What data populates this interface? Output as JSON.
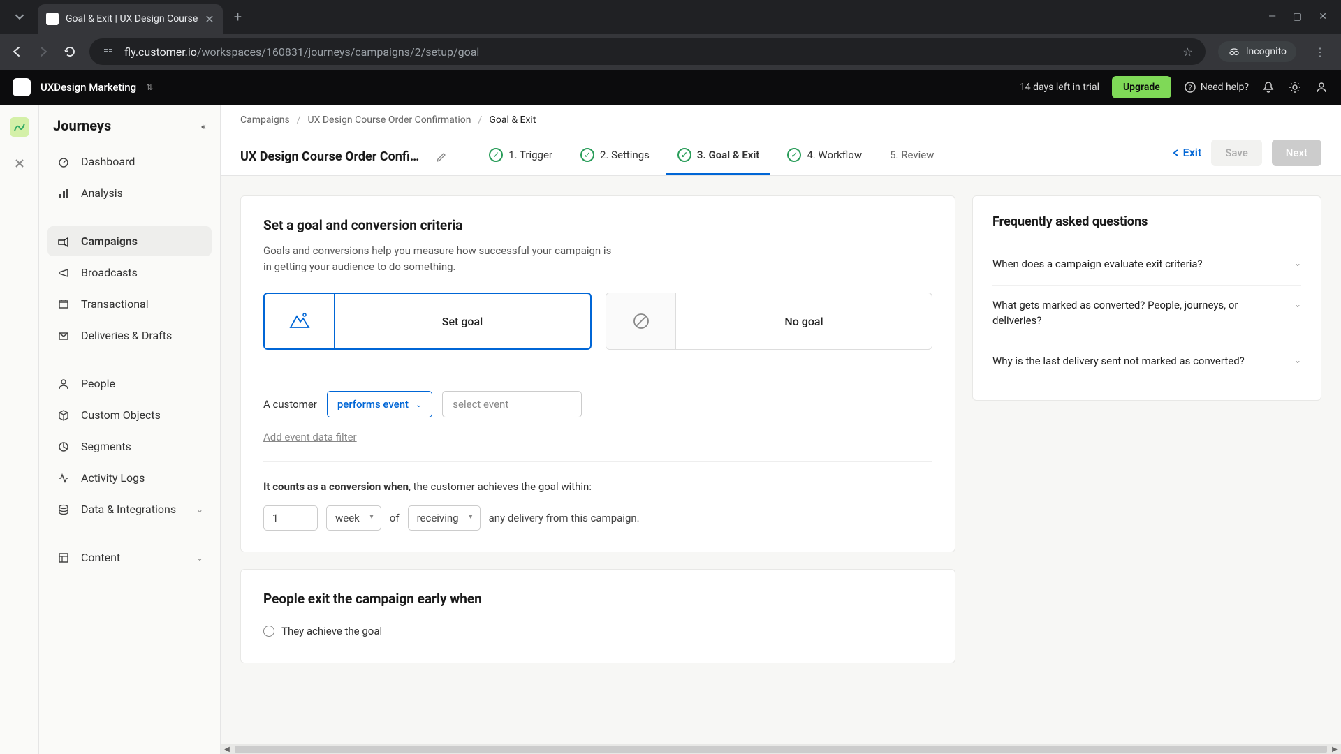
{
  "browser": {
    "tab_title": "Goal & Exit | UX Design Course",
    "url_host": "fly.customer.io",
    "url_path": "/workspaces/160831/journeys/campaigns/2/setup/goal",
    "incognito": "Incognito"
  },
  "topbar": {
    "workspace": "UXDesign Marketing",
    "trial": "14 days left in trial",
    "upgrade": "Upgrade",
    "help": "Need help?"
  },
  "sidebar": {
    "title": "Journeys",
    "items": [
      {
        "label": "Dashboard"
      },
      {
        "label": "Analysis"
      },
      {
        "label": "Campaigns"
      },
      {
        "label": "Broadcasts"
      },
      {
        "label": "Transactional"
      },
      {
        "label": "Deliveries & Drafts"
      },
      {
        "label": "People"
      },
      {
        "label": "Custom Objects"
      },
      {
        "label": "Segments"
      },
      {
        "label": "Activity Logs"
      },
      {
        "label": "Data & Integrations"
      },
      {
        "label": "Content"
      }
    ]
  },
  "breadcrumb": {
    "a": "Campaigns",
    "b": "UX Design Course Order Confirmation",
    "c": "Goal & Exit"
  },
  "wizard": {
    "title": "UX Design Course Order Confi…",
    "steps": {
      "s1": "1. Trigger",
      "s2": "2. Settings",
      "s3": "3. Goal & Exit",
      "s4": "4. Workflow",
      "s5": "5. Review"
    },
    "exit": "Exit",
    "save": "Save",
    "next": "Next"
  },
  "goal": {
    "heading": "Set a goal and conversion criteria",
    "desc": "Goals and conversions help you measure how successful your campaign is in getting your audience to do something.",
    "opt_set": "Set goal",
    "opt_none": "No goal",
    "customer_prefix": "A customer",
    "performs_event": "performs event",
    "select_event_ph": "select event",
    "add_filter": "Add event data filter",
    "conv_prefix_bold": "It counts as a conversion when",
    "conv_prefix_rest": ", the customer achieves the goal within:",
    "conv_num": "1",
    "conv_unit": "week",
    "conv_of": "of",
    "conv_action": "receiving",
    "conv_tail": "any delivery from this campaign."
  },
  "exit_section": {
    "heading": "People exit the campaign early when",
    "opt1": "They achieve the goal"
  },
  "faq": {
    "heading": "Frequently asked questions",
    "q1": "When does a campaign evaluate exit criteria?",
    "q2": "What gets marked as converted? People, journeys, or deliveries?",
    "q3": "Why is the last delivery sent not marked as converted?"
  }
}
